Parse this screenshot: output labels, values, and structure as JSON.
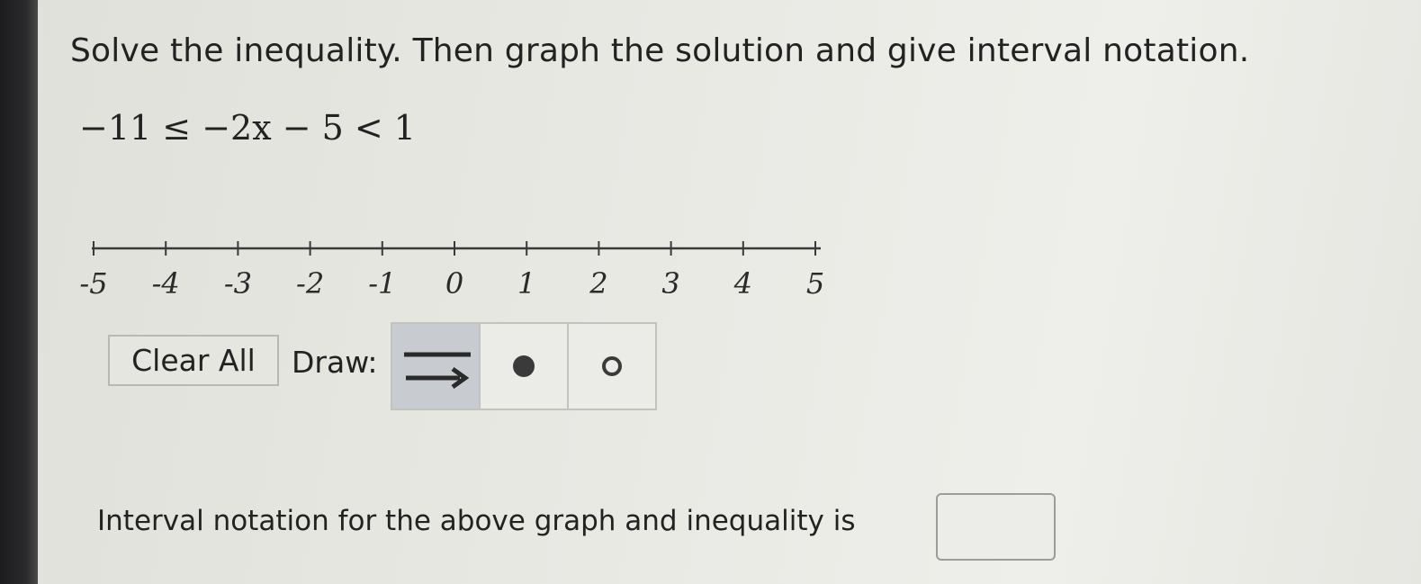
{
  "question": {
    "prompt": "Solve the inequality. Then graph the solution and give interval notation.",
    "inequality": "−11 ≤ −2x − 5 < 1"
  },
  "number_line": {
    "min": -5,
    "max": 5,
    "tick_labels": [
      "-5",
      "-4",
      "-3",
      "-2",
      "-1",
      "0",
      "1",
      "2",
      "3",
      "4",
      "5"
    ]
  },
  "toolbar": {
    "clear_all_label": "Clear All",
    "draw_label": "Draw:",
    "tools": [
      {
        "name": "ray-tool",
        "icon": "line-ray-icon",
        "selected": true
      },
      {
        "name": "closed-dot-tool",
        "icon": "closed-dot-icon",
        "selected": false
      },
      {
        "name": "open-dot-tool",
        "icon": "open-dot-icon",
        "selected": false
      }
    ]
  },
  "answer": {
    "label": "Interval notation for the above graph and inequality is",
    "value": ""
  }
}
